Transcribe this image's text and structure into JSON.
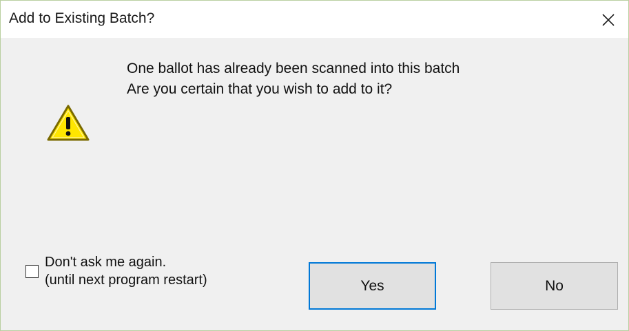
{
  "dialog": {
    "title": "Add to Existing Batch?",
    "close_icon": "close-x-icon",
    "icon": "warning-triangle-icon",
    "message_lines": [
      "One ballot has already been scanned into this batch",
      "Are you certain that you wish to add to it?"
    ],
    "checkbox": {
      "checked": false,
      "label_line1": "Don't ask me again.",
      "label_line2": "(until next program restart)"
    },
    "buttons": {
      "yes_label": "Yes",
      "no_label": "No"
    },
    "colors": {
      "accent": "#0078d7",
      "warning_fill": "#ffe600",
      "warning_stroke": "#8a7400"
    }
  }
}
